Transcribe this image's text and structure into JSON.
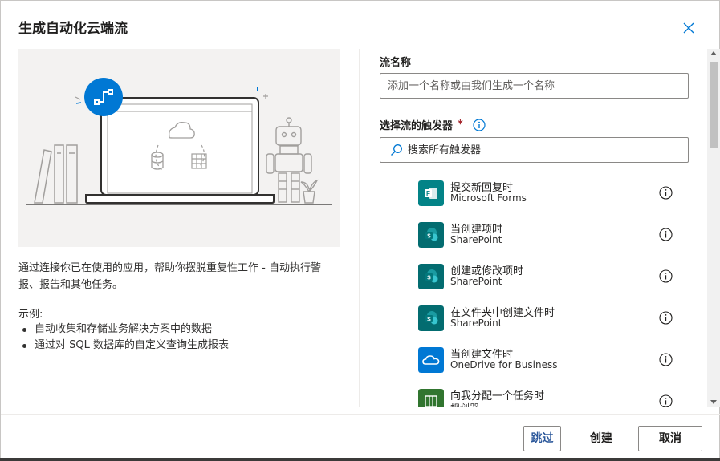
{
  "dialog": {
    "title": "生成自动化云端流",
    "close_icon": "close-icon"
  },
  "left": {
    "description": "通过连接你已在使用的应用，帮助你摆脱重复性工作 - 自动执行警报、报告和其他任务。",
    "examples_title": "示例:",
    "examples": [
      "自动收集和存储业务解决方案中的数据",
      "通过对 SQL 数据库的自定义查询生成报表"
    ]
  },
  "right": {
    "flow_name_label": "流名称",
    "flow_name_placeholder": "添加一个名称或由我们生成一个名称",
    "trigger_label": "选择流的触发器",
    "required_mark": "*",
    "search_placeholder": "搜索所有触发器",
    "triggers": [
      {
        "name": "提交新回复时",
        "connector": "Microsoft Forms",
        "icon": "forms-icon",
        "color": "#038387"
      },
      {
        "name": "当创建项时",
        "connector": "SharePoint",
        "icon": "sharepoint-icon",
        "color": "#036c70"
      },
      {
        "name": "创建或修改项时",
        "connector": "SharePoint",
        "icon": "sharepoint-icon",
        "color": "#036c70"
      },
      {
        "name": "在文件夹中创建文件时",
        "connector": "SharePoint",
        "icon": "sharepoint-icon",
        "color": "#036c70"
      },
      {
        "name": "当创建文件时",
        "connector": "OneDrive for Business",
        "icon": "onedrive-icon",
        "color": "#0078d4"
      },
      {
        "name": "向我分配一个任务时",
        "connector": "规划器",
        "icon": "planner-icon",
        "color": "#31752f"
      }
    ]
  },
  "footer": {
    "skip_label": "跳过",
    "create_label": "创建",
    "cancel_label": "取消"
  },
  "colors": {
    "accent": "#0078d4",
    "skip_text": "#2b579a"
  }
}
